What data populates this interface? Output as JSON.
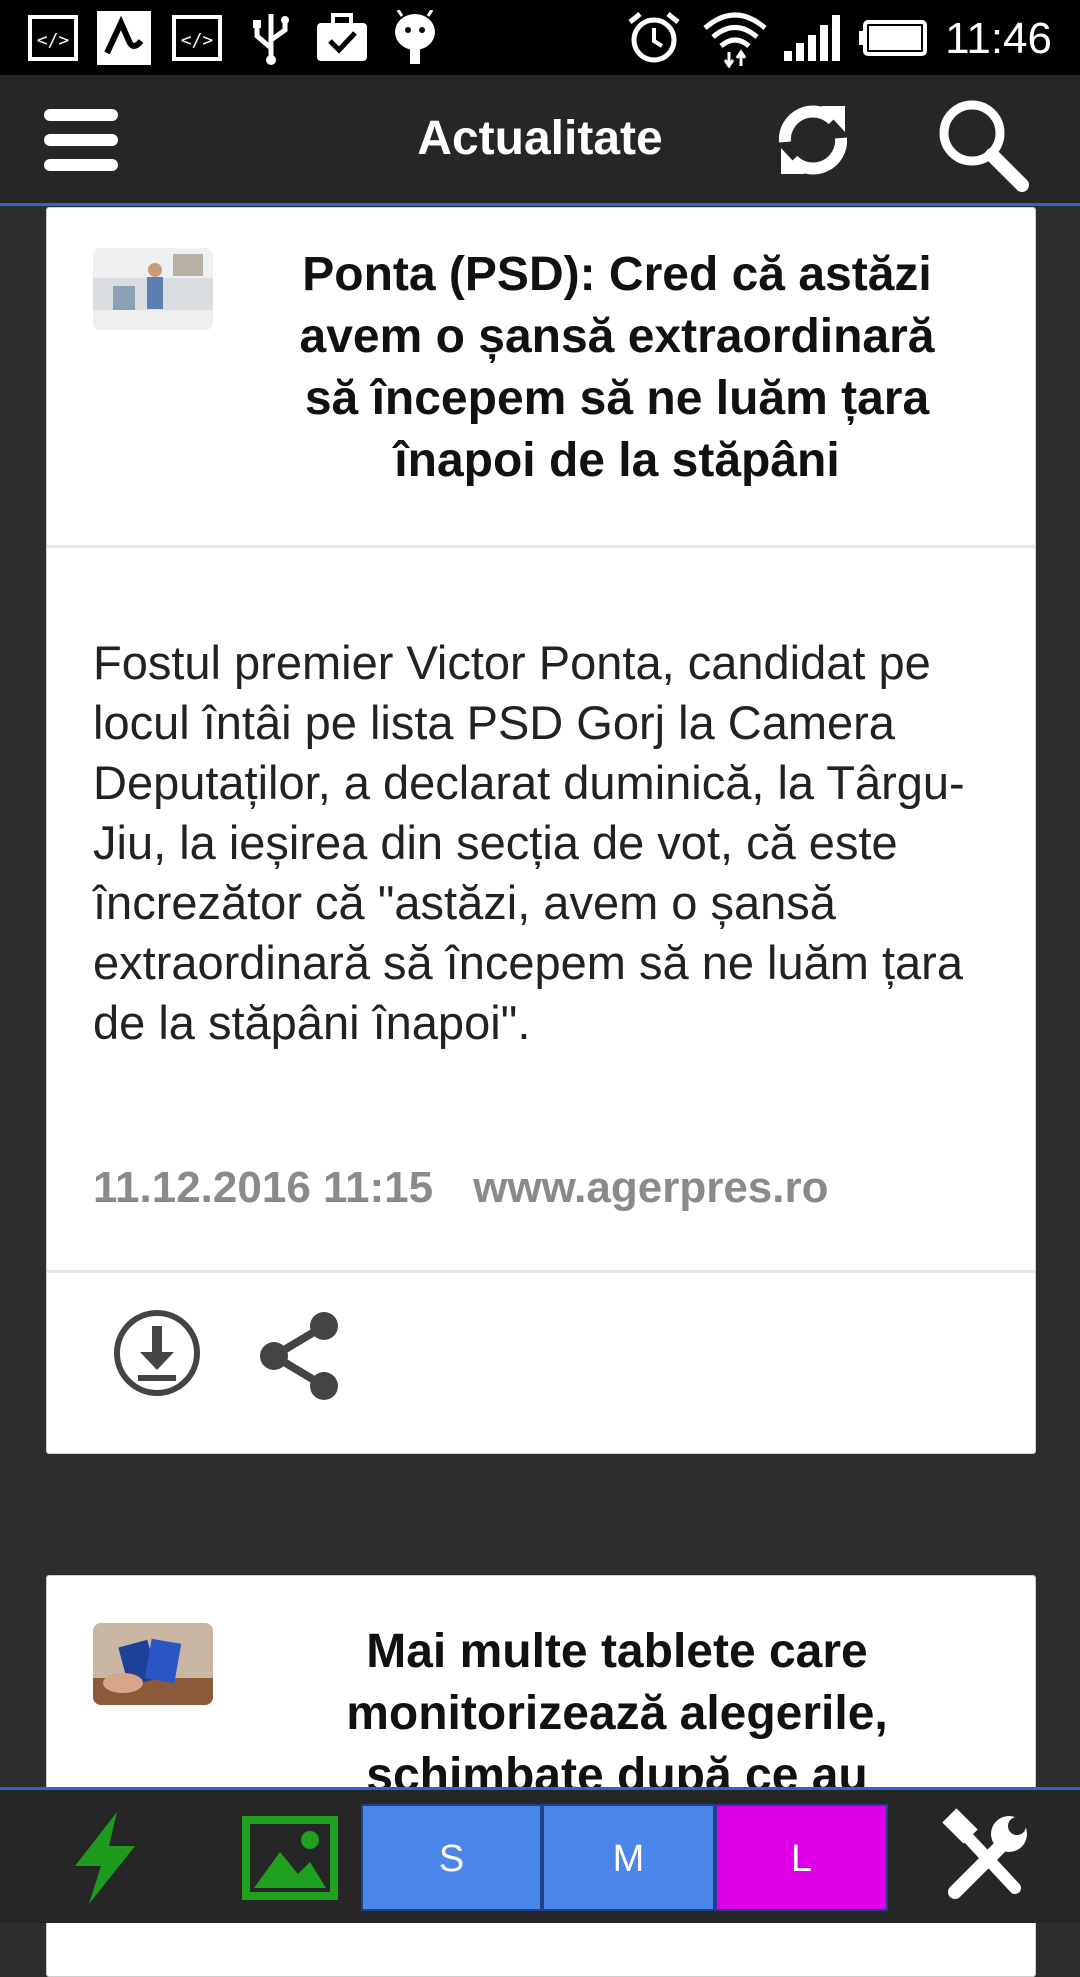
{
  "status_bar": {
    "time": "11:46",
    "icons": [
      "code-icon",
      "avira-icon",
      "code-icon",
      "usb-icon",
      "briefcase-check-icon",
      "android-icon",
      "alarm-icon",
      "wifi-icon",
      "signal-icon",
      "battery-icon"
    ]
  },
  "action_bar": {
    "title": "Actualitate",
    "icons": [
      "menu-icon",
      "refresh-icon",
      "search-icon"
    ]
  },
  "articles": [
    {
      "headline": "Ponta (PSD): Cred că astăzi avem o șansă extraordinară să începem să ne luăm țara înapoi de la stăpâni",
      "body": "Fostul premier Victor Ponta, candidat pe locul întâi pe lista PSD Gorj la Camera Deputaților, a declarat duminică, la Târgu-Jiu, la ieșirea din secția de vot, că este încrezător că \"astăzi, avem o șansă extraordinară să începem să ne luăm țara de la stăpâni înapoi\".",
      "date": "11.12.2016 11:15",
      "source": "www.agerpres.ro",
      "actions": [
        "download-icon",
        "share-icon"
      ]
    },
    {
      "headline": "Mai multe tablete care monitorizează alegerile, schimbate după ce au"
    }
  ],
  "bottom_bar": {
    "icons": [
      "flash-icon",
      "image-icon",
      "tools-icon"
    ],
    "sizes": [
      {
        "label": "S",
        "color": "#4a86e8"
      },
      {
        "label": "M",
        "color": "#4a86e8"
      },
      {
        "label": "L",
        "color": "#e000e8"
      }
    ]
  },
  "colors": {
    "accent": "#2f66c7",
    "bar_background": "#262626",
    "flash_green": "#1e9a1e",
    "image_green": "#1fa01f"
  }
}
